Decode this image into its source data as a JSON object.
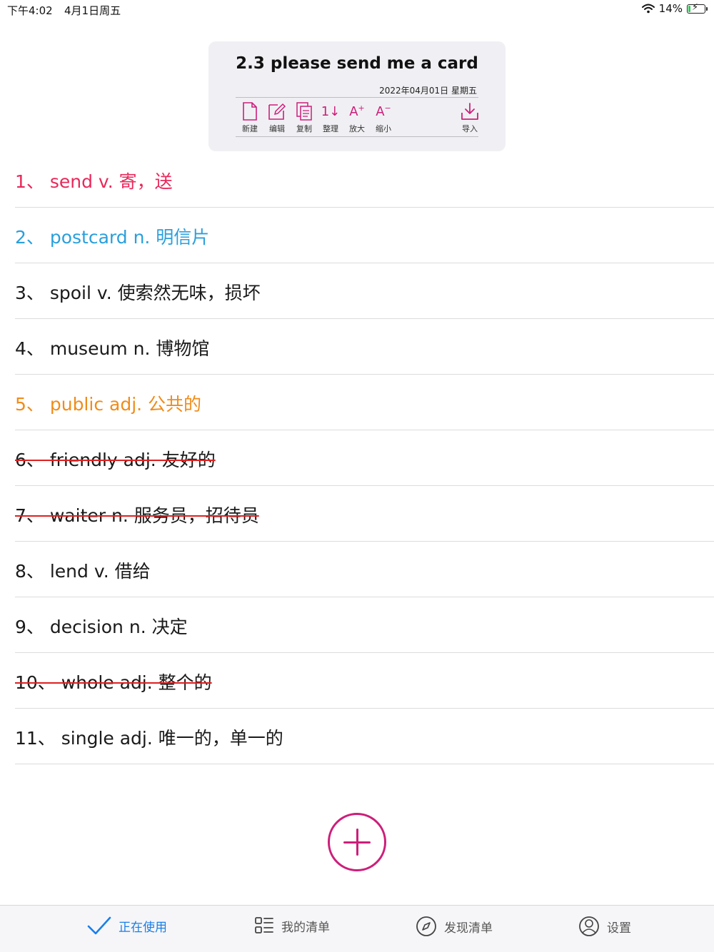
{
  "status_bar": {
    "time": "下午4:02",
    "date": "4月1日周五",
    "battery_percent": "14%",
    "battery_level": 0.14
  },
  "header": {
    "title": "2.3 please send me a card",
    "date": "2022年04月01日 星期五",
    "tools": [
      {
        "label": "新建",
        "icon": "new-document-icon"
      },
      {
        "label": "编辑",
        "icon": "edit-icon"
      },
      {
        "label": "复制",
        "icon": "copy-icon"
      },
      {
        "label": "整理",
        "icon": "sort-icon"
      },
      {
        "label": "放大",
        "icon": "font-increase-icon"
      },
      {
        "label": "缩小",
        "icon": "font-decrease-icon"
      },
      {
        "label": "导入",
        "icon": "import-icon"
      }
    ],
    "enlarge_glyph": "A",
    "shrink_glyph": "A",
    "sort_glyph": "1",
    "accent_color": "#cc1f7a"
  },
  "words": [
    {
      "text": "1、 send  v. 寄，送",
      "color": "#e8285a",
      "struck": false
    },
    {
      "text": "2、 postcard  n. 明信片",
      "color": "#2a9fdc",
      "struck": false
    },
    {
      "text": "3、 spoil  v. 使索然无味，损坏",
      "color": "#1a1a1a",
      "struck": false
    },
    {
      "text": "4、 museum  n. 博物馆",
      "color": "#1a1a1a",
      "struck": false
    },
    {
      "text": "5、 public  adj. 公共的",
      "color": "#f08c1a",
      "struck": false
    },
    {
      "text": "6、 friendly  adj. 友好的",
      "color": "#1a1a1a",
      "struck": true
    },
    {
      "text": "7、 waiter  n. 服务员，招待员",
      "color": "#1a1a1a",
      "struck": true
    },
    {
      "text": "8、 lend  v. 借给",
      "color": "#1a1a1a",
      "struck": false
    },
    {
      "text": "9、 decision  n. 决定",
      "color": "#1a1a1a",
      "struck": false
    },
    {
      "text": "10、 whole  adj. 整个的",
      "color": "#1a1a1a",
      "struck": true
    },
    {
      "text": "11、 single  adj. 唯一的，单一的",
      "color": "#1a1a1a",
      "struck": false
    }
  ],
  "tab_bar": {
    "tabs": [
      {
        "label": "正在使用",
        "icon": "checkmark-icon",
        "active": true
      },
      {
        "label": "我的清单",
        "icon": "list-icon",
        "active": false
      },
      {
        "label": "发现清单",
        "icon": "compass-icon",
        "active": false
      },
      {
        "label": "设置",
        "icon": "person-icon",
        "active": false
      }
    ],
    "active_color": "#1a7fe8"
  }
}
